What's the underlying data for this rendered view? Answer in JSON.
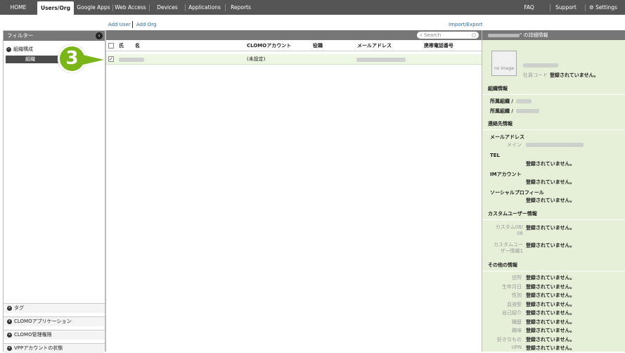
{
  "topnav": {
    "tabs": [
      "HOME",
      "Users/Org",
      "Google Apps",
      "Web Access",
      "Devices",
      "Applications",
      "Reports"
    ],
    "right": [
      "FAQ",
      "Support",
      "Settings"
    ]
  },
  "actions": {
    "add_user": "Add User",
    "add_org": "Add Org",
    "import_export": "Import/Export"
  },
  "filter": {
    "title": "フィルター",
    "org_tree": "組織構成",
    "org_item": "組織",
    "sections": [
      "タグ",
      "CLOMOアプリケーション",
      "CLOMO管理権限",
      "VPPアカウントの状態"
    ]
  },
  "search": {
    "placeholder": "Search"
  },
  "grid": {
    "headers": [
      "氏",
      "名",
      "CLOMOアカウント",
      "役職",
      "メールアドレス",
      "携帯電話番号"
    ],
    "row": {
      "account": "(未設定)"
    }
  },
  "step_badge": "3",
  "detail": {
    "header": "\" の詳細情報",
    "no_image": "no image",
    "emp_code_label": "社員コード",
    "unregistered": "登録されていません。",
    "org_section": "組織情報",
    "org_label": "所属組織 /",
    "contact_section": "連絡先情報",
    "email_label": "メールアドレス",
    "main_label": "メイン",
    "tel_label": "TEL",
    "im_label": "IMアカウント",
    "social_label": "ソーシャルプロフィール",
    "custom_section": "カスタムユーザー情報",
    "custom1": "カスタム08/\n06",
    "custom2": "カスタムユー\nザー情報1",
    "other_section": "その他の情報",
    "other_fields": [
      "住所",
      "生年月日",
      "性別",
      "血液型",
      "自己紹介",
      "職歴",
      "趣味",
      "好きなもの",
      "UPN"
    ]
  }
}
